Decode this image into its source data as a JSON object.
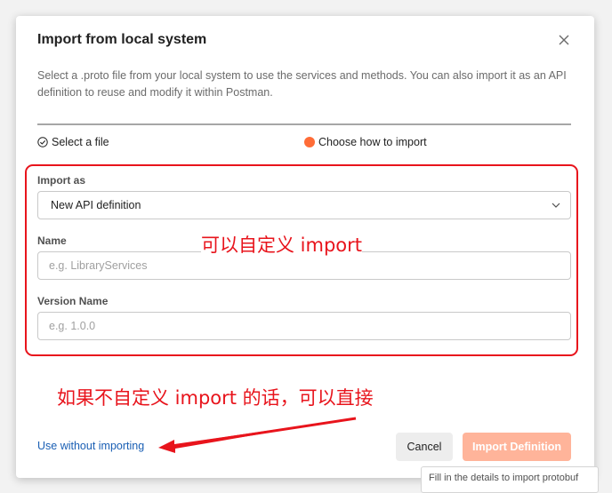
{
  "modal": {
    "title": "Import from local system",
    "description": "Select a .proto file from your local system to use the services and methods. You can also import it as an API definition to reuse and modify it within Postman."
  },
  "steps": [
    {
      "label": "Select a file",
      "icon": "check-circle-icon",
      "state": "complete"
    },
    {
      "label": "Choose how to import",
      "icon": "orange-dot-icon",
      "state": "current"
    }
  ],
  "form": {
    "import_as": {
      "label": "Import as",
      "value": "New API definition"
    },
    "name": {
      "label": "Name",
      "value": "",
      "placeholder": "e.g. LibraryServices"
    },
    "version_name": {
      "label": "Version Name",
      "value": "",
      "placeholder": "e.g. 1.0.0"
    }
  },
  "footer": {
    "use_without_label": "Use without importing",
    "cancel_label": "Cancel",
    "import_label": "Import Definition",
    "tooltip": "Fill in the details to import protobuf"
  },
  "annotations": {
    "note_1": "可以自定义 import",
    "note_2": "如果不自定义 import 的话，可以直接"
  },
  "colors": {
    "accent": "#ff6c37",
    "import_button_disabled": "#ffb49a",
    "link": "#1a5fb4",
    "annotation": "#e8141c"
  }
}
